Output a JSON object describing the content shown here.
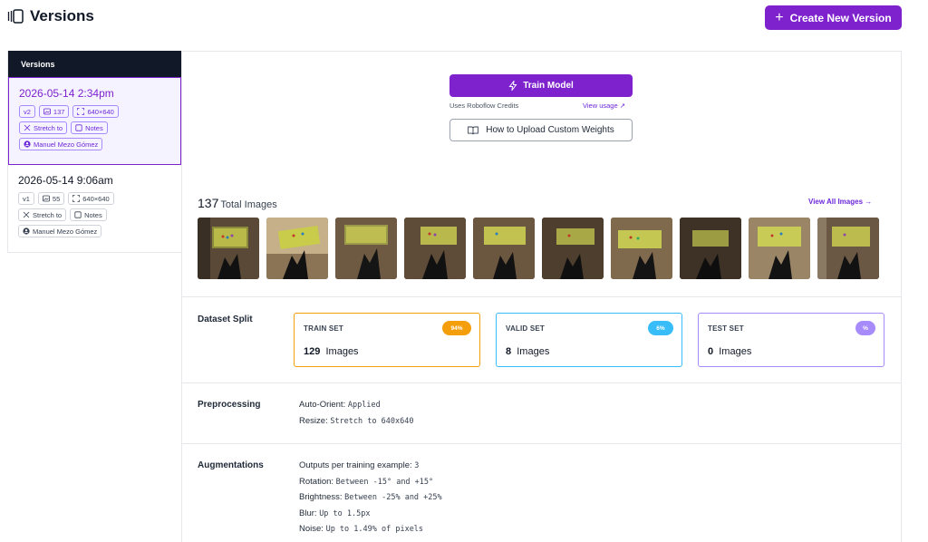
{
  "header": {
    "title": "Versions",
    "create_button": "Create New Version",
    "accent": "#7e22ce"
  },
  "sidebar": {
    "heading": "Versions",
    "versions": [
      {
        "date": "2026-05-14 2:34pm",
        "version": "v2",
        "image_count": "137",
        "size": "640×640",
        "resize": "Stretch to",
        "notes": "Notes",
        "author": "Manuel Mezo Gómez",
        "selected": true
      },
      {
        "date": "2026-05-14 9:06am",
        "version": "v1",
        "image_count": "55",
        "size": "640×640",
        "resize": "Stretch to",
        "notes": "Notes",
        "author": "Manuel Mezo Gómez",
        "selected": false
      }
    ]
  },
  "train": {
    "button": "Train Model",
    "credits_text": "Uses Roboflow Credits",
    "usage_link": "View usage",
    "weights_button": "How to Upload Custom Weights"
  },
  "images": {
    "count": "137",
    "label": "Total Images",
    "view_all": "View All Images"
  },
  "dataset_split": {
    "label": "Dataset Split",
    "sets": [
      {
        "name": "TRAIN SET",
        "badge": "94%",
        "count": "129",
        "unit": "Images",
        "color": "#f59e0b"
      },
      {
        "name": "VALID SET",
        "badge": "6%",
        "count": "8",
        "unit": "Images",
        "color": "#38bdf8"
      },
      {
        "name": "TEST SET",
        "badge": "%",
        "count": "0",
        "unit": "Images",
        "color": "#a78bfa"
      }
    ]
  },
  "preprocessing": {
    "label": "Preprocessing",
    "items": [
      {
        "key": "Auto-Orient:",
        "value": "Applied"
      },
      {
        "key": "Resize:",
        "value": "Stretch to 640x640"
      }
    ]
  },
  "augmentations": {
    "label": "Augmentations",
    "items": [
      {
        "key": "Outputs per training example:",
        "value": "3"
      },
      {
        "key": "Rotation:",
        "value": "Between -15° and +15°"
      },
      {
        "key": "Brightness:",
        "value": "Between -25% and +25%"
      },
      {
        "key": "Blur:",
        "value": "Up to 1.5px"
      },
      {
        "key": "Noise:",
        "value": "Up to 1.49% of pixels"
      }
    ]
  }
}
